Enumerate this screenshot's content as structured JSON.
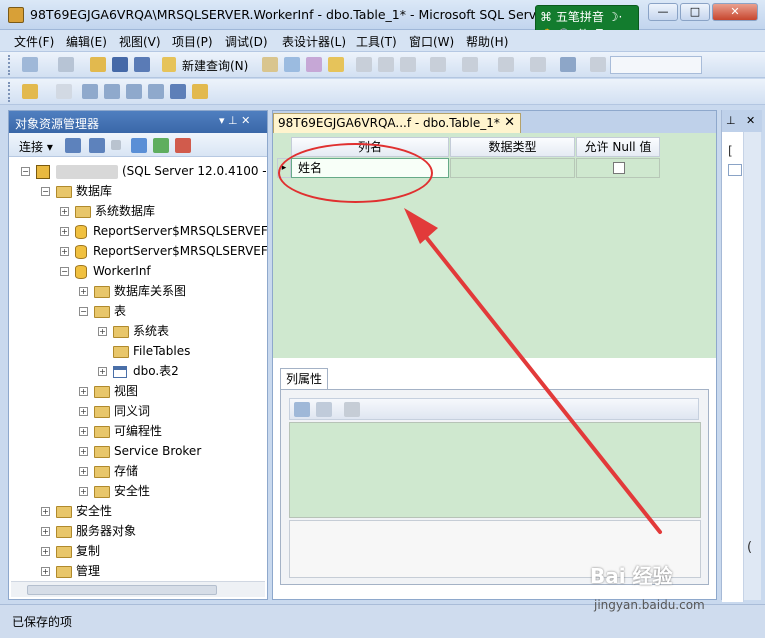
{
  "window": {
    "title": "98T69EGJGA6VRQA\\MRSQLSERVER.WorkerInf - dbo.Table_1* - Microsoft SQL Server M",
    "min_label": "—",
    "max_label": "□",
    "close_label": "✕"
  },
  "ime": {
    "name": "五笔拼音",
    "mode1": "简",
    "mode2": "品"
  },
  "menu": [
    "文件(F)",
    "编辑(E)",
    "视图(V)",
    "项目(P)",
    "调试(D)",
    "表设计器(L)",
    "工具(T)",
    "窗口(W)",
    "帮助(H)"
  ],
  "toolbar": {
    "new_query": "新建查询(N)"
  },
  "explorer": {
    "title": "对象资源管理器",
    "pin": "▾ ⊥ ✕",
    "connect": "连接 ▾",
    "server_version": "(SQL Server 12.0.4100 -",
    "nodes": {
      "databases": "数据库",
      "system_dbs": "系统数据库",
      "report1": "ReportServer$MRSQLSERVEF",
      "report2": "ReportServer$MRSQLSERVEF",
      "workerinf": "WorkerInf",
      "diagrams": "数据库关系图",
      "tables": "表",
      "system_tables": "系统表",
      "filetables": "FileTables",
      "table2": "dbo.表2",
      "views": "视图",
      "synonyms": "同义词",
      "programmability": "可编程性",
      "service_broker": "Service Broker",
      "storage": "存储",
      "security_inner": "安全性",
      "security": "安全性",
      "server_objects": "服务器对象",
      "replication": "复制",
      "management": "管理"
    }
  },
  "document": {
    "tab_label": "98T69EGJGA6VRQA...f - dbo.Table_1*",
    "tab_close": "✕",
    "columns": [
      "列名",
      "数据类型",
      "允许 Null 值"
    ],
    "row_value": "姓名"
  },
  "properties": {
    "tab_label": "列属性"
  },
  "status": {
    "text": "已保存的项"
  },
  "watermark": {
    "brand": "Bai 经验",
    "url": "jingyan.baidu.com"
  },
  "colors": {
    "grid_green": "#cfe8cf",
    "annotation_red": "#e03030",
    "panel_blue": "#3a67a8"
  }
}
